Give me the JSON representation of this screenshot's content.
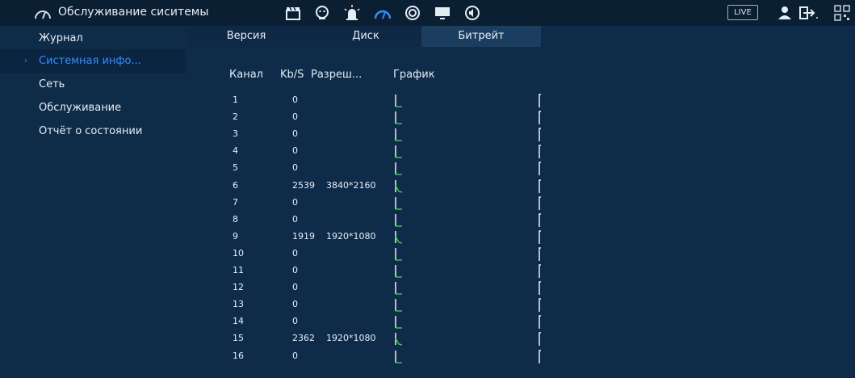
{
  "header": {
    "title": "Обслуживание сиситемы",
    "title_icon": "speedometer-icon",
    "toolbar_icons": [
      "clapperboard-icon",
      "face-icon",
      "alarm-light-icon",
      "speedometer-icon",
      "target-icon",
      "monitor-icon",
      "speaker-icon"
    ],
    "live_label": "LIVE",
    "accent": "#2f8fff"
  },
  "sidebar": {
    "items": [
      {
        "label": "Журнал"
      },
      {
        "label": "Системная инфо..."
      },
      {
        "label": "Сеть"
      },
      {
        "label": "Обслуживание"
      },
      {
        "label": "Отчёт о состоянии"
      }
    ],
    "active_index": 1,
    "active_marker": "›"
  },
  "tabs": [
    {
      "label": "Версия"
    },
    {
      "label": "Диск"
    },
    {
      "label": "Битрейт"
    }
  ],
  "active_tab": 2,
  "table": {
    "columns": [
      "Канал",
      "Kb/S",
      "Разреш...",
      "График"
    ],
    "rows": [
      {
        "ch": "1",
        "kbs": "0",
        "res": ""
      },
      {
        "ch": "2",
        "kbs": "0",
        "res": ""
      },
      {
        "ch": "3",
        "kbs": "0",
        "res": ""
      },
      {
        "ch": "4",
        "kbs": "0",
        "res": ""
      },
      {
        "ch": "5",
        "kbs": "0",
        "res": ""
      },
      {
        "ch": "6",
        "kbs": "2539",
        "res": "3840*2160"
      },
      {
        "ch": "7",
        "kbs": "0",
        "res": ""
      },
      {
        "ch": "8",
        "kbs": "0",
        "res": ""
      },
      {
        "ch": "9",
        "kbs": "1919",
        "res": "1920*1080"
      },
      {
        "ch": "10",
        "kbs": "0",
        "res": ""
      },
      {
        "ch": "11",
        "kbs": "0",
        "res": ""
      },
      {
        "ch": "12",
        "kbs": "0",
        "res": ""
      },
      {
        "ch": "13",
        "kbs": "0",
        "res": ""
      },
      {
        "ch": "14",
        "kbs": "0",
        "res": ""
      },
      {
        "ch": "15",
        "kbs": "2362",
        "res": "1920*1080"
      },
      {
        "ch": "16",
        "kbs": "0",
        "res": ""
      }
    ]
  }
}
